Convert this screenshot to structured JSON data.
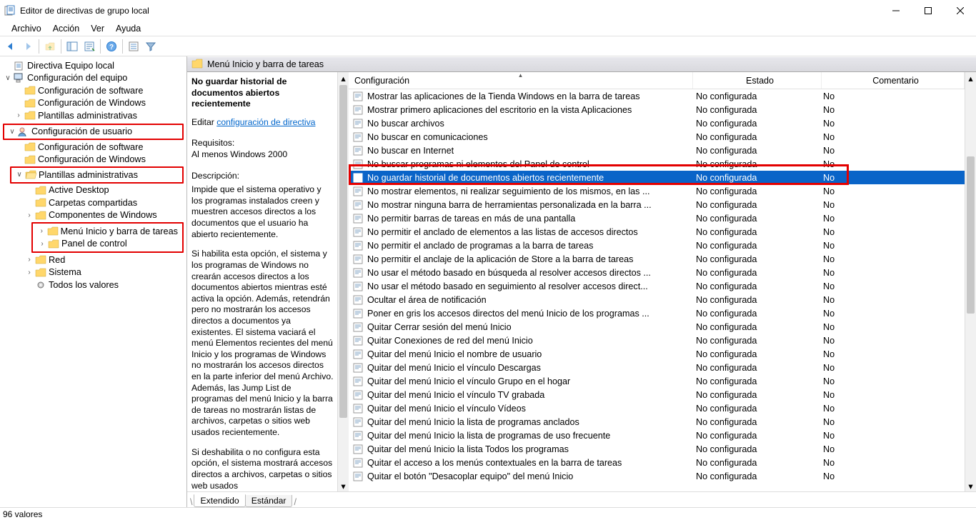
{
  "title": "Editor de directivas de grupo local",
  "menus": [
    "Archivo",
    "Acción",
    "Ver",
    "Ayuda"
  ],
  "location": "Menú Inicio y barra de tareas",
  "tree": {
    "root": "Directiva Equipo local",
    "cfg_equipo": "Configuración del equipo",
    "cfg_software": "Configuración de software",
    "cfg_windows": "Configuración de Windows",
    "plantillas_adm1": "Plantillas administrativas",
    "cfg_usuario": "Configuración de usuario",
    "cfg_software2": "Configuración de software",
    "cfg_windows2": "Configuración de Windows",
    "plantillas_adm2": "Plantillas administrativas",
    "active_desktop": "Active Desktop",
    "carpetas_comp": "Carpetas compartidas",
    "comp_windows": "Componentes de Windows",
    "menu_inicio": "Menú Inicio y barra de tareas",
    "panel_control": "Panel de control",
    "red": "Red",
    "sistema": "Sistema",
    "todos_valores": "Todos los valores"
  },
  "help": {
    "name": "No guardar historial de documentos abiertos recientemente",
    "edit_label": "Editar",
    "edit_link": "configuración de directiva",
    "req_label": "Requisitos:",
    "req_text": "Al menos Windows 2000",
    "desc_label": "Descripción:",
    "desc1": "Impide que el sistema operativo y los programas instalados creen y muestren accesos directos a los documentos que el usuario ha abierto recientemente.",
    "desc2": "Si habilita esta opción, el sistema y los programas de Windows no crearán accesos directos a los documentos abiertos mientras esté activa la opción. Además, retendrán pero no mostrarán los accesos directos a documentos ya existentes. El sistema vaciará el menú Elementos recientes del menú Inicio y los programas de Windows no mostrarán los accesos directos en la parte inferior del menú Archivo. Además, las Jump List de programas del menú Inicio y la barra de tareas no mostrarán listas de archivos, carpetas o sitios web usados recientemente.",
    "desc3": "Si deshabilita o no configura esta opción, el sistema mostrará accesos directos a archivos, carpetas o sitios web usados"
  },
  "columns": {
    "c1": "Configuración",
    "c2": "Estado",
    "c3": "Comentario"
  },
  "estado": "No configurada",
  "com": "No",
  "rows": [
    "Mostrar las aplicaciones de la Tienda Windows en la barra de tareas",
    "Mostrar primero aplicaciones del escritorio en la vista Aplicaciones",
    "No buscar archivos",
    "No buscar en comunicaciones",
    "No buscar en Internet",
    "No buscar programas ni elementos del Panel de control",
    "No guardar historial de documentos abiertos recientemente",
    "No mostrar elementos, ni realizar seguimiento de los mismos, en las ...",
    "No mostrar ninguna barra de herramientas personalizada en la barra ...",
    "No permitir barras de tareas en más de una pantalla",
    "No permitir el anclado de elementos a las listas de accesos directos",
    "No permitir el anclado de programas a la barra de tareas",
    "No permitir el anclaje de la aplicación de Store a la barra de tareas",
    "No usar el método basado en búsqueda al resolver accesos directos ...",
    "No usar el método basado en seguimiento al resolver accesos direct...",
    "Ocultar el área de notificación",
    "Poner en gris los accesos directos del menú Inicio de los programas ...",
    "Quitar Cerrar sesión del menú Inicio",
    "Quitar Conexiones de red del menú Inicio",
    "Quitar del menú Inicio el nombre de usuario",
    "Quitar del menú Inicio el vínculo Descargas",
    "Quitar del menú Inicio el vínculo Grupo en el hogar",
    "Quitar del menú Inicio el vínculo TV grabada",
    "Quitar del menú Inicio el vínculo Vídeos",
    "Quitar del menú Inicio la lista de programas anclados",
    "Quitar del menú Inicio la lista de programas de uso frecuente",
    "Quitar del menú Inicio la lista Todos los programas",
    "Quitar el acceso a los menús contextuales en la barra de tareas",
    "Quitar el botón \"Desacoplar equipo\" del menú Inicio"
  ],
  "selected_index": 6,
  "tabs": {
    "ext": "Extendido",
    "std": "Estándar"
  },
  "status": "96 valores"
}
